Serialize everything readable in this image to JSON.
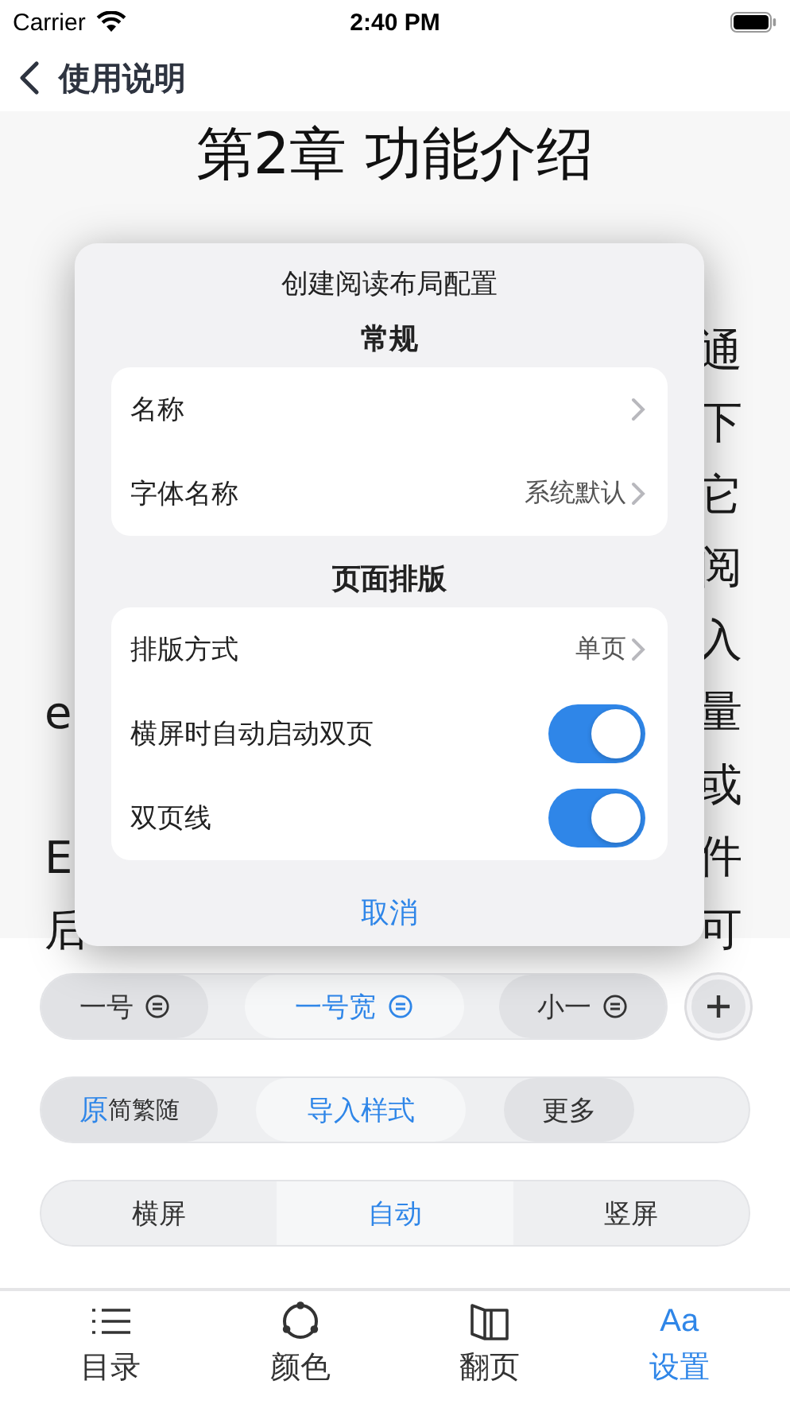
{
  "status_bar": {
    "carrier": "Carrier",
    "time": "2:40 PM"
  },
  "nav": {
    "title": "使用说明"
  },
  "document": {
    "title": "第2章 功能介绍",
    "lines": [
      {
        "right": "通"
      },
      {
        "right": "下"
      },
      {
        "right": "它"
      },
      {
        "right": "阅"
      },
      {
        "right": "入"
      },
      {
        "left": "e",
        "right": "量"
      },
      {
        "right": "或"
      },
      {
        "left": "E",
        "right": "件"
      },
      {
        "left": "后",
        "right": "可"
      }
    ]
  },
  "dialog": {
    "title": "创建阅读布局配置",
    "sections": [
      {
        "header": "常规",
        "rows": [
          {
            "kind": "link",
            "label": "名称"
          },
          {
            "kind": "link",
            "label": "字体名称",
            "value": "系统默认"
          }
        ]
      },
      {
        "header": "页面排版",
        "rows": [
          {
            "kind": "link",
            "label": "排版方式",
            "value": "单页"
          },
          {
            "kind": "toggle",
            "label": "横屏时自动启动双页",
            "on": true
          },
          {
            "kind": "toggle",
            "label": "双页线",
            "on": true
          }
        ]
      }
    ],
    "cancel": "取消"
  },
  "font_styles": [
    {
      "label": "一号",
      "selected": false
    },
    {
      "label": "一号宽",
      "selected": true
    },
    {
      "label": "小一",
      "selected": false
    }
  ],
  "text_options": [
    {
      "kind": "script",
      "primary": "原",
      "secondary": "简繁随",
      "selected": false
    },
    {
      "kind": "plain",
      "label": "导入样式",
      "selected": true
    },
    {
      "kind": "plain",
      "label": "更多",
      "selected": false
    }
  ],
  "orientation": [
    {
      "label": "横屏",
      "selected": false
    },
    {
      "label": "自动",
      "selected": true
    },
    {
      "label": "竖屏",
      "selected": false
    }
  ],
  "tab_bar": [
    {
      "kind": "list",
      "label": "目录",
      "selected": false
    },
    {
      "kind": "palette",
      "label": "颜色",
      "selected": false
    },
    {
      "kind": "book",
      "label": "翻页",
      "selected": false
    },
    {
      "kind": "text",
      "icon": "Aa",
      "label": "设置",
      "selected": true
    }
  ]
}
